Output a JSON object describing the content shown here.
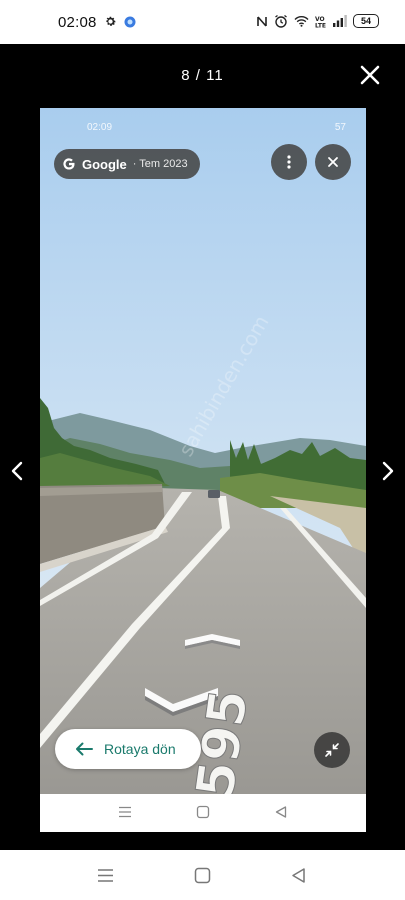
{
  "status_bar": {
    "time": "02:08",
    "battery": "54",
    "icons": [
      "gear-icon",
      "app-badge-icon",
      "nfc-icon",
      "alarm-icon",
      "wifi-icon",
      "volte-icon",
      "signal-icon",
      "battery-icon"
    ]
  },
  "viewer": {
    "counter": "8 / 11",
    "icons": [
      "close-icon",
      "chevron-left-icon",
      "chevron-right-icon"
    ]
  },
  "screenshot": {
    "inner_status": {
      "time": "02:09",
      "battery": "57"
    },
    "google_pill": {
      "brand": "Google",
      "date": "· Tem 2023"
    },
    "return_button": {
      "label": "Rotaya dön"
    },
    "road_marking": "595",
    "watermark": "sahibinden.com",
    "icons": [
      "more-vertical-icon",
      "close-icon",
      "arrow-left-icon",
      "collapse-icon",
      "menu-icon",
      "home-square-icon",
      "back-triangle-icon"
    ]
  },
  "bottom_nav": {
    "icons": [
      "menu-icon",
      "home-square-icon",
      "back-triangle-icon"
    ]
  },
  "colors": {
    "accent": "#1a7a6c",
    "viewer_bg": "#000000",
    "pill_bg": "#464646"
  }
}
